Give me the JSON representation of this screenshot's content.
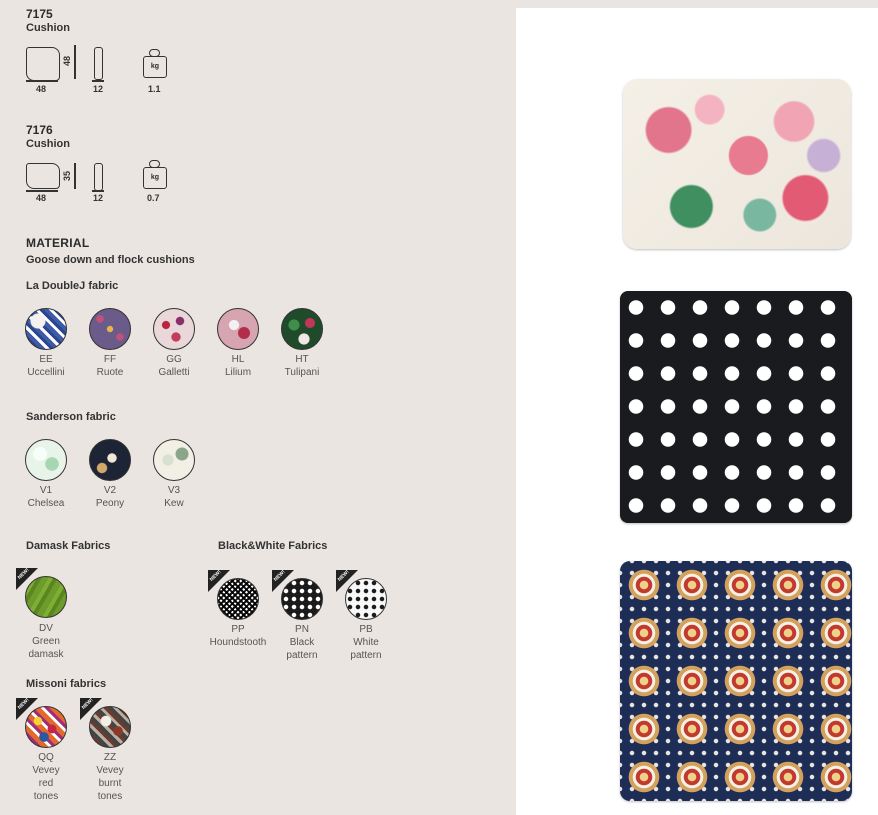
{
  "products": [
    {
      "code": "7175",
      "type": "Cushion",
      "dims": {
        "width": "48",
        "height": "48",
        "thickness": "12",
        "weight": "1.1",
        "weight_unit": "kg"
      }
    },
    {
      "code": "7176",
      "type": "Cushion",
      "dims": {
        "width": "48",
        "height": "35",
        "thickness": "12",
        "weight": "0.7",
        "weight_unit": "kg"
      }
    }
  ],
  "material": {
    "heading": "MATERIAL",
    "description": "Goose down and flock cushions"
  },
  "sections": {
    "ladoublej": {
      "title": "La DoubleJ fabric",
      "swatches": [
        {
          "code": "EE",
          "name": "Uccellini"
        },
        {
          "code": "FF",
          "name": "Ruote"
        },
        {
          "code": "GG",
          "name": "Galletti"
        },
        {
          "code": "HL",
          "name": "Lilium"
        },
        {
          "code": "HT",
          "name": "Tulipani"
        }
      ]
    },
    "sanderson": {
      "title": "Sanderson fabric",
      "swatches": [
        {
          "code": "V1",
          "name": "Chelsea"
        },
        {
          "code": "V2",
          "name": "Peony"
        },
        {
          "code": "V3",
          "name": "Kew"
        }
      ]
    },
    "damask": {
      "title": "Damask Fabrics",
      "swatches": [
        {
          "code": "DV",
          "name1": "Green",
          "name2": "damask",
          "badge": "NEW!"
        }
      ]
    },
    "bw": {
      "title": "Black&White Fabrics",
      "swatches": [
        {
          "code": "PP",
          "name": "Houndstooth",
          "badge": "NEW!"
        },
        {
          "code": "PN",
          "name1": "Black",
          "name2": "pattern",
          "badge": "NEW!"
        },
        {
          "code": "PB",
          "name1": "White",
          "name2": "pattern",
          "badge": "NEW!"
        }
      ]
    },
    "missoni": {
      "title": "Missoni fabrics",
      "swatches": [
        {
          "code": "QQ",
          "name1": "Vevey",
          "name2": "red",
          "name3": "tones",
          "badge": "NEW!"
        },
        {
          "code": "ZZ",
          "name1": "Vevey",
          "name2": "burnt",
          "name3": "tones",
          "badge": "NEW!"
        }
      ]
    }
  }
}
